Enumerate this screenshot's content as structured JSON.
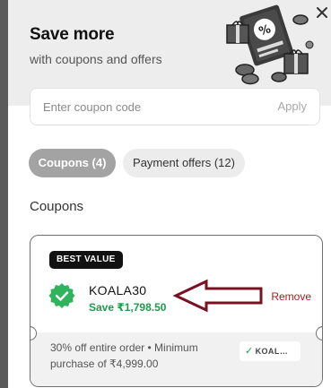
{
  "header": {
    "title": "Save more",
    "subtitle": "with coupons and offers",
    "close_icon": "close-icon",
    "illustration_icon": "coupon-percent-gift-illustration"
  },
  "coupon_entry": {
    "placeholder": "Enter coupon code",
    "value": "",
    "apply_label": "Apply"
  },
  "tabs": [
    {
      "label": "Coupons (4)",
      "active": true
    },
    {
      "label": "Payment offers (12)",
      "active": false
    }
  ],
  "section_title": "Coupons",
  "coupon": {
    "badge": "BEST VALUE",
    "code": "KOALA30",
    "save_text": "Save ₹1,798.50",
    "remove_label": "Remove",
    "description": "30% off entire order • Minimum purchase of ₹4,999.00",
    "chip_label": "KOAL…",
    "seal_icon": "verified-seal-icon",
    "arrow_annotation": "left-arrow-annotation"
  },
  "colors": {
    "active_tab": "#a3a3a3",
    "save_green": "#1e9b4a",
    "remove_red": "#a32020",
    "arrow_maroon": "#7a1020",
    "badge_black": "#111111"
  }
}
